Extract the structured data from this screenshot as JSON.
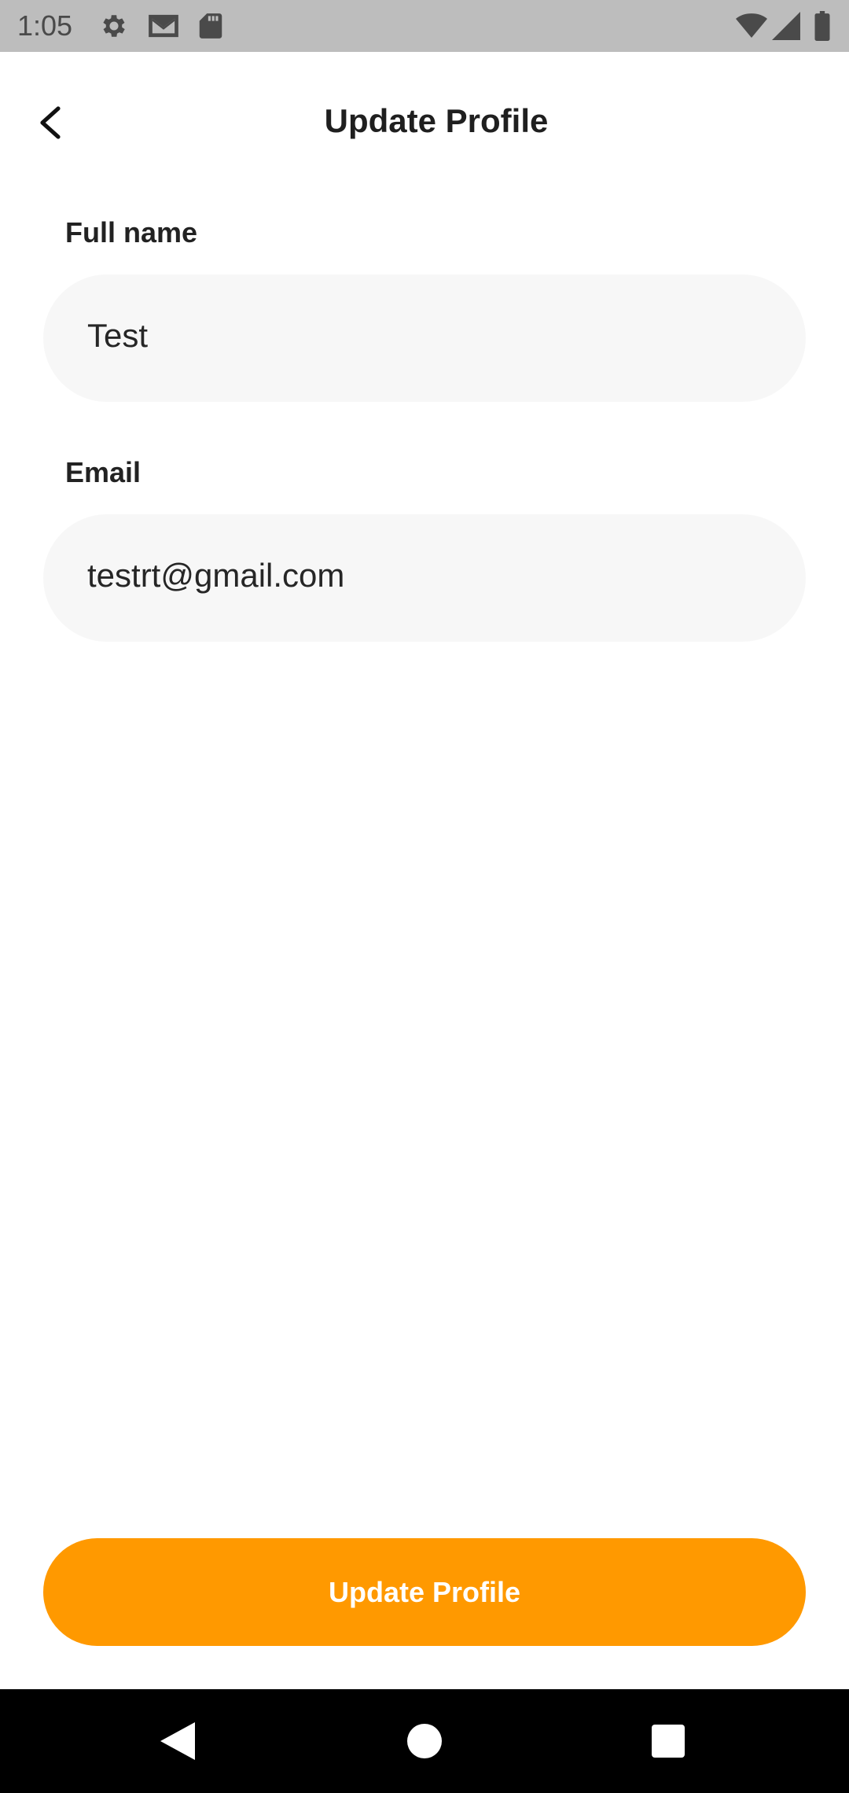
{
  "status_bar": {
    "time": "1:05",
    "left_icons": [
      "gear-icon",
      "gmail-icon",
      "sd-card-icon"
    ],
    "right_icons": [
      "wifi-icon",
      "cell-signal-icon",
      "battery-icon"
    ],
    "background": "#bdbdbd"
  },
  "app_bar": {
    "title": "Update Profile",
    "back_icon": "chevron-left-icon"
  },
  "form": {
    "full_name": {
      "label": "Full name",
      "value": "Test"
    },
    "email": {
      "label": "Email",
      "value": "testrt@gmail.com"
    },
    "field_background": "#f7f7f7"
  },
  "actions": {
    "submit_label": "Update Profile",
    "accent_color": "#ff9900"
  },
  "nav_bar": {
    "buttons": [
      "back-triangle-icon",
      "home-circle-icon",
      "recents-square-icon"
    ]
  }
}
